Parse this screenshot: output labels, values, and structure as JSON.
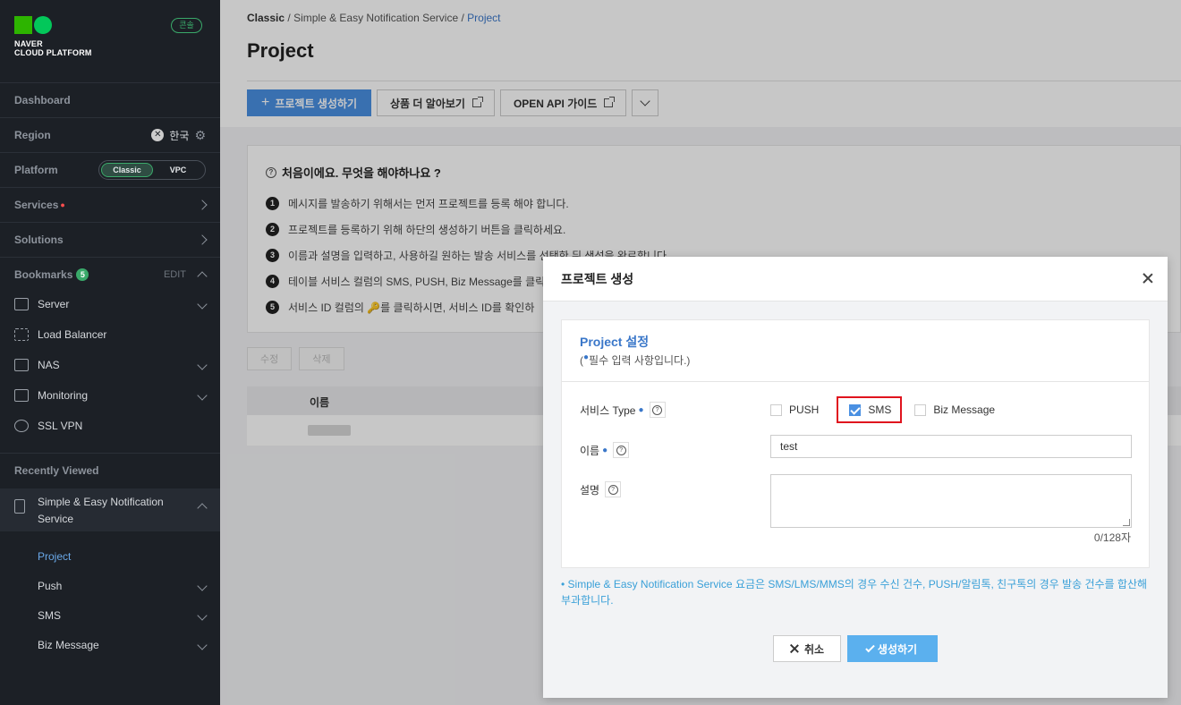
{
  "sidebar": {
    "brand_line1": "NAVER",
    "brand_line2": "CLOUD PLATFORM",
    "console_badge": "콘솔",
    "dashboard": "Dashboard",
    "region_label": "Region",
    "region_value": "한국",
    "platform_label": "Platform",
    "platform_options": [
      "Classic",
      "VPC"
    ],
    "services_label": "Services",
    "services_dot": "●",
    "solutions_label": "Solutions",
    "bookmarks_label": "Bookmarks",
    "bookmarks_count": "5",
    "bookmarks_edit": "EDIT",
    "bookmark_items": [
      "Server",
      "Load Balancer",
      "NAS",
      "Monitoring",
      "SSL VPN"
    ],
    "recently_viewed_label": "Recently Viewed",
    "recent_service": "Simple & Easy Notification Service",
    "recent_sub_items": [
      "Project",
      "Push",
      "SMS",
      "Biz Message"
    ]
  },
  "breadcrumb": {
    "root": "Classic",
    "sep": "/",
    "service": "Simple & Easy Notification Service",
    "current": "Project"
  },
  "page_title": "Project",
  "toolbar": {
    "create_label": "프로젝트 생성하기",
    "create_icon_text": "+",
    "learn_more_label": "상품 더 알아보기",
    "api_guide_label": "OPEN API 가이드"
  },
  "help": {
    "title": "처음이에요. 무엇을 해야하나요 ?",
    "steps": [
      {
        "num": "1",
        "text": "메시지를 발송하기 위해서는 먼저 프로젝트를 등록 해야 합니다."
      },
      {
        "num": "2",
        "text": "프로젝트를 등록하기 위해 하단의 생성하기 버튼을 클릭하세요."
      },
      {
        "num": "3",
        "text": "이름과 설명을 입력하고, 사용하길 원하는 발송 서비스를 선택한 뒤 생성을 완료합니다."
      },
      {
        "num": "4",
        "text": "테이블 서비스 컬럼의 SMS, PUSH, Biz Message를 클릭"
      },
      {
        "num": "5",
        "text": "서비스 ID 컬럼의 🔑를 클릭하시면, 서비스 ID를 확인하"
      }
    ]
  },
  "table": {
    "edit_label": "수정",
    "delete_label": "삭제",
    "col_name": "이름"
  },
  "modal": {
    "title": "프로젝트 생성",
    "section_title": "Project 설정",
    "required_note_open": "(",
    "required_dot": "●",
    "required_note_text": "필수 입력 사항입니다.)",
    "service_type_label": "서비스 Type",
    "service_options": [
      {
        "label": "PUSH",
        "checked": false
      },
      {
        "label": "SMS",
        "checked": true
      },
      {
        "label": "Biz Message",
        "checked": false
      }
    ],
    "name_label": "이름",
    "name_value": "test",
    "desc_label": "설명",
    "desc_value": "",
    "char_counter": "0/128자",
    "pricing_note": "•  Simple & Easy Notification Service 요금은 SMS/LMS/MMS의 경우 수신 건수, PUSH/알림톡, 친구톡의 경우 발송 건수를 합산해 부과합니다.",
    "cancel_label": "취소",
    "create_label": "생성하기"
  },
  "colors": {
    "accent": "#4a90e2",
    "sidebar_bg": "#1c2026",
    "highlight": "#e0141e"
  }
}
